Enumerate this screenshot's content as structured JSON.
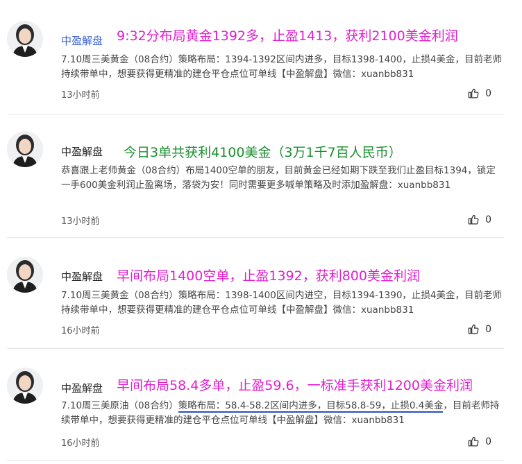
{
  "posts": [
    {
      "author": "中盈解盘",
      "headline": "9:32分布局黄金1392多，止盈1413，获利2100美金利润",
      "content": "7.10周三美黄金（08合约）策略布局：1394-1392区间内进多，目标1398-1400，止损4美金，目前老师持续带单中，想要获得更精准的建仓平仓点位可单线【中盈解盘】微信：xuanbb831",
      "time": "13小时前",
      "likes": "0"
    },
    {
      "author": "中盈解盘",
      "headline": "今日3单共获利4100美金（3万1千7百人民币）",
      "content": "恭喜跟上老师黄金（08合约）布局1400空单的朋友，目前黄金已经如期下跌至我们止盈目标1394，锁定一手600美金利润止盈离场，落袋为安！同时需要更多喊单策略及时添加盈解盘：xuanbb831",
      "time": "13小时前",
      "likes": "0"
    },
    {
      "author": "中盈解盘",
      "headline": "早间布局1400空单，止盈1392，获利800美金利润",
      "content": "7.10周三美黄金（08合约）策略布局：1398-1400区间内进空，目标1394-1390，止损4美金，目前老师持续带单中，想要获得更精准的建仓平仓点位可单线【中盈解盘】微信：xuanbb831",
      "time": "16小时前",
      "likes": "0"
    },
    {
      "author": "中盈解盘",
      "headline": "早间布局58.4多单，止盈59.6，一标准手获利1200美金利润",
      "content_pre": "7.10周三美原油（08合约）",
      "content_underlined": "策略布局：58.4-58.2区间内进多，目标58.8-59，止损0.4美金",
      "content_post": "，目前老师持续带单中，想要获得更精准的建仓平仓点位可单线【中盈解盘】微信：xuanbb831",
      "time": "16小时前",
      "likes": "0"
    }
  ],
  "colors": {
    "author_link": "#3b63d6",
    "author_dark": "#222222",
    "headline_magenta": "#e11fd0",
    "headline_green": "#1a8f2e",
    "underline": "#2c4fc0"
  }
}
